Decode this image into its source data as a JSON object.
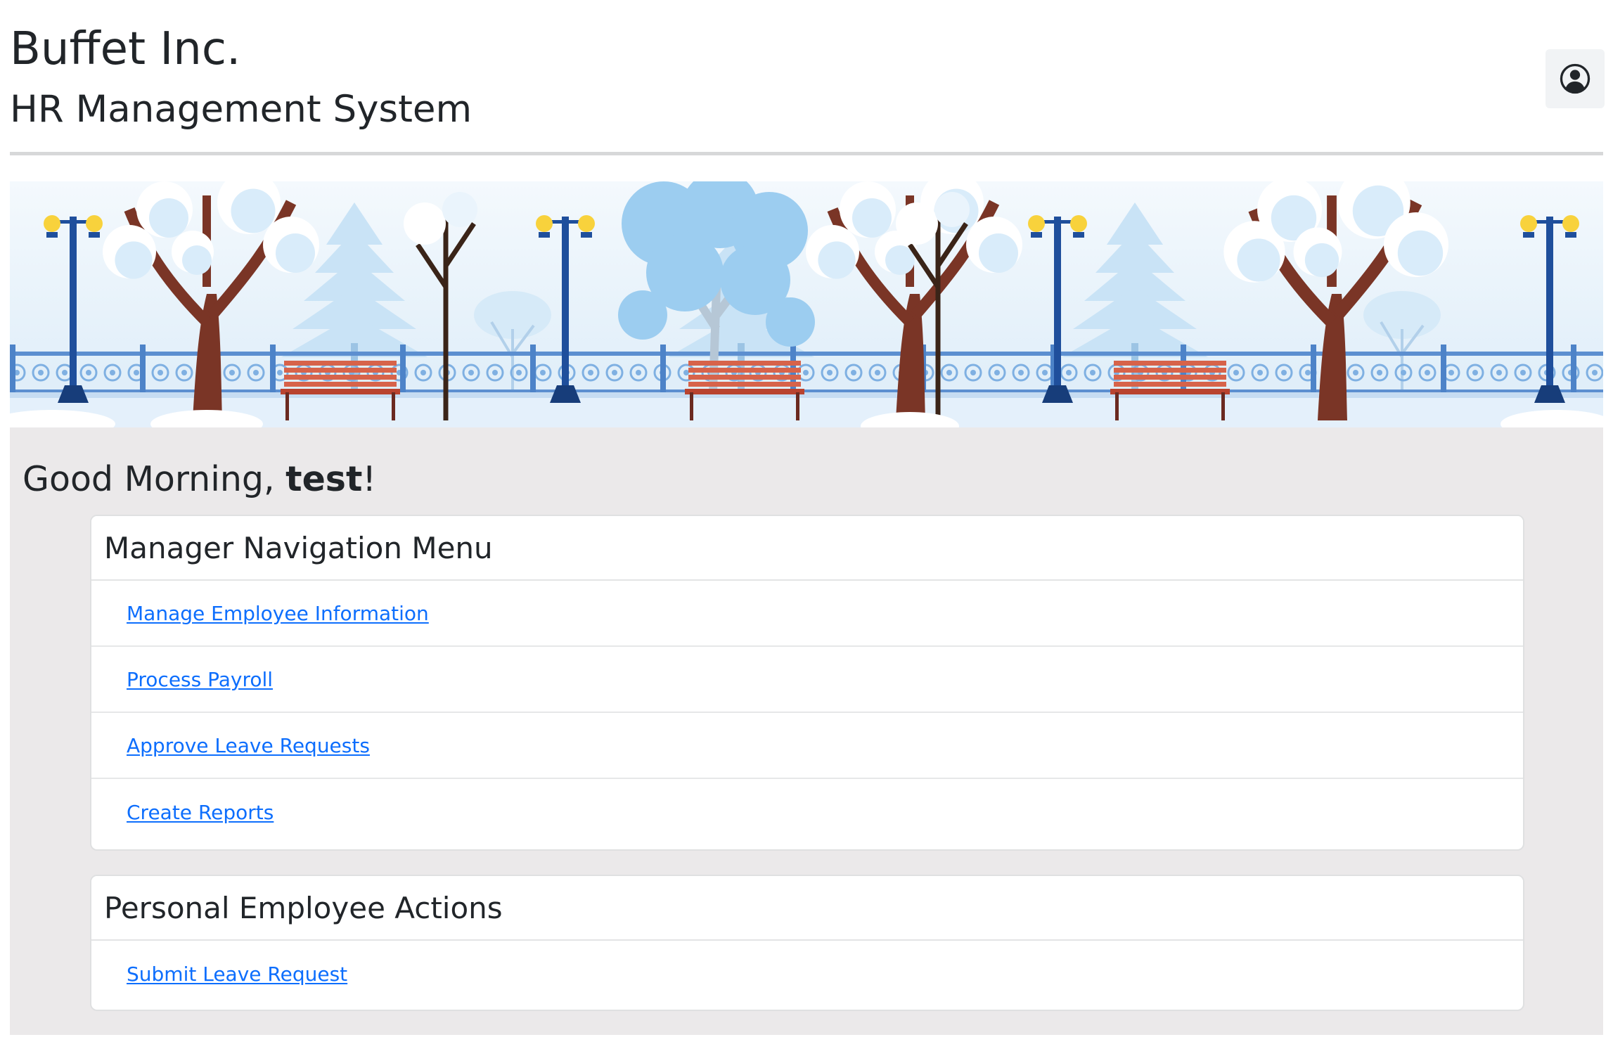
{
  "header": {
    "company_name": "Buffet Inc.",
    "system_name": "HR Management System",
    "profile_icon": "person-circle-icon"
  },
  "banner": {
    "scene": "winter-park-illustration"
  },
  "greeting": {
    "prefix": "Good Morning, ",
    "username": "test",
    "suffix": "!"
  },
  "manager_menu": {
    "title": "Manager Navigation Menu",
    "items": [
      {
        "label": "Manage Employee Information"
      },
      {
        "label": "Process Payroll"
      },
      {
        "label": "Approve Leave Requests"
      },
      {
        "label": "Create Reports"
      }
    ]
  },
  "employee_actions": {
    "title": "Personal Employee Actions",
    "items": [
      {
        "label": "Submit Leave Request"
      }
    ]
  },
  "colors": {
    "link": "#0d6efd",
    "main_background": "#ebe9ea",
    "sky": "#e8f3fb"
  }
}
